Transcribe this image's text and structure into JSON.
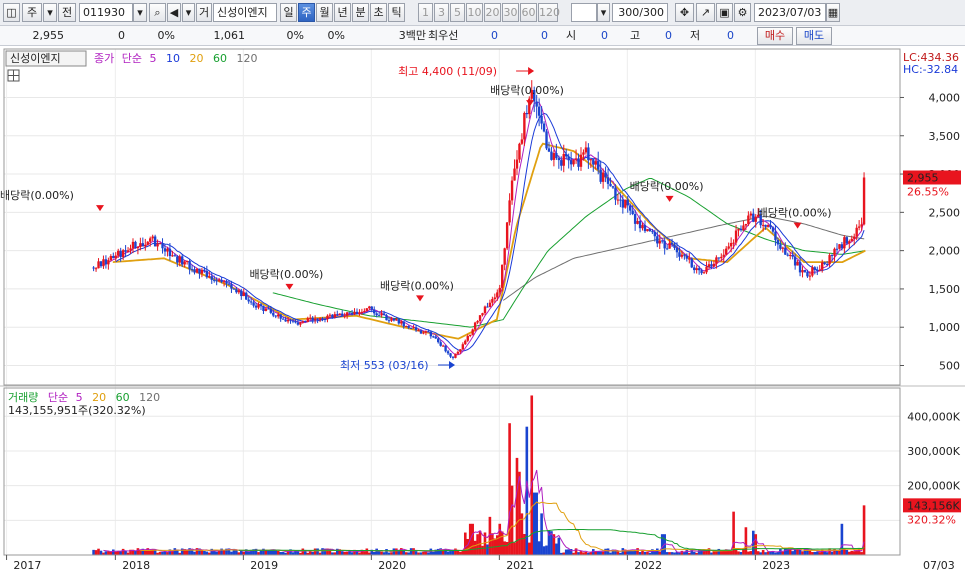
{
  "toolbar": {
    "market_label": "주",
    "prev_label": "전",
    "code": "011930",
    "type_label": "거",
    "stock_name": "신성이엔지",
    "periods": [
      "일",
      "주",
      "월",
      "년",
      "분",
      "초",
      "틱"
    ],
    "selected_period": "주",
    "intervals": [
      "1",
      "3",
      "5",
      "10",
      "20",
      "30",
      "60",
      "120"
    ],
    "count": "300/300",
    "date": "2023/07/03"
  },
  "quote": {
    "price": "2,955",
    "change": "0",
    "change_pct": "0%",
    "volume": "1,061",
    "vol_pct1": "0%",
    "vol_pct2": "0%",
    "bid_unit": "3백만",
    "best_label": "최우선",
    "best1": "0",
    "best2": "0",
    "open_label": "시",
    "open": "0",
    "high_label": "고",
    "high": "0",
    "low_label": "저",
    "low": "0",
    "buy_label": "매수",
    "sell_label": "매도"
  },
  "colors": {
    "up": "#e8141e",
    "down": "#1a44d0",
    "ma5": "#b020c0",
    "ma10": "#1a3ad8",
    "ma20": "#e0a010",
    "ma60": "#18a030",
    "ma120": "#707070"
  },
  "chart_data": [
    {
      "type": "candlestick",
      "legend": {
        "stock": "신성이엔지",
        "price_type": "종가",
        "ma_type": "단순",
        "periods": [
          "5",
          "10",
          "20",
          "60",
          "120"
        ]
      },
      "right_info": {
        "lc": "LC:434.36",
        "hc": "HC:-32.84"
      },
      "y_ticks": [
        500,
        1000,
        1500,
        2000,
        2500,
        3000,
        3500,
        4000
      ],
      "y_tick_labels": [
        "500",
        "1,000",
        "1,500",
        "2,000",
        "2,500",
        "3,000",
        "3,500",
        "4,000"
      ],
      "ylim": [
        350,
        4450
      ],
      "current_price_label": "2,955",
      "current_change_label": "26.55%",
      "x_labels": [
        "2017",
        "2018",
        "2019",
        "2020",
        "2021",
        "2022",
        "2023",
        "07/03"
      ],
      "annotations": {
        "high": "최고 4,400 (11/09)",
        "low": "최저 553 (03/16)",
        "ex_dividend": "배당락(0.00%)"
      },
      "close_path": [
        [
          2017.45,
          1780
        ],
        [
          2017.6,
          1900
        ],
        [
          2017.75,
          2050
        ],
        [
          2017.9,
          2150
        ],
        [
          2018.0,
          2000
        ],
        [
          2018.15,
          1850
        ],
        [
          2018.3,
          1700
        ],
        [
          2018.45,
          1600
        ],
        [
          2018.6,
          1450
        ],
        [
          2018.75,
          1250
        ],
        [
          2018.9,
          1150
        ],
        [
          2019.0,
          1050
        ],
        [
          2019.1,
          1080
        ],
        [
          2019.3,
          1150
        ],
        [
          2019.5,
          1200
        ],
        [
          2019.6,
          1250
        ],
        [
          2019.7,
          1150
        ],
        [
          2019.85,
          1050
        ],
        [
          2020.0,
          950
        ],
        [
          2020.1,
          900
        ],
        [
          2020.2,
          700
        ],
        [
          2020.25,
          600
        ],
        [
          2020.35,
          800
        ],
        [
          2020.45,
          1100
        ],
        [
          2020.55,
          1350
        ],
        [
          2020.62,
          1500
        ],
        [
          2020.68,
          2300
        ],
        [
          2020.72,
          3000
        ],
        [
          2020.78,
          3400
        ],
        [
          2020.86,
          4050
        ],
        [
          2020.92,
          3800
        ],
        [
          2021.0,
          3300
        ],
        [
          2021.1,
          3200
        ],
        [
          2021.2,
          3100
        ],
        [
          2021.3,
          3300
        ],
        [
          2021.4,
          3000
        ],
        [
          2021.5,
          2800
        ],
        [
          2021.6,
          2600
        ],
        [
          2021.7,
          2350
        ],
        [
          2021.8,
          2200
        ],
        [
          2021.9,
          2100
        ],
        [
          2022.0,
          2000
        ],
        [
          2022.1,
          1850
        ],
        [
          2022.2,
          1700
        ],
        [
          2022.3,
          1850
        ],
        [
          2022.4,
          2000
        ],
        [
          2022.5,
          2300
        ],
        [
          2022.6,
          2450
        ],
        [
          2022.7,
          2350
        ],
        [
          2022.8,
          2100
        ],
        [
          2022.9,
          1900
        ],
        [
          2023.0,
          1700
        ],
        [
          2023.1,
          1750
        ],
        [
          2023.2,
          1900
        ],
        [
          2023.3,
          2100
        ],
        [
          2023.38,
          2200
        ],
        [
          2023.45,
          2300
        ],
        [
          2023.48,
          2955
        ]
      ],
      "ma_paths": {
        "ma20": [
          [
            2017.6,
            1850
          ],
          [
            2018.0,
            1900
          ],
          [
            2018.5,
            1550
          ],
          [
            2019.0,
            1100
          ],
          [
            2019.5,
            1150
          ],
          [
            2020.0,
            950
          ],
          [
            2020.3,
            850
          ],
          [
            2020.6,
            1100
          ],
          [
            2020.75,
            2300
          ],
          [
            2020.95,
            3400
          ],
          [
            2021.2,
            3300
          ],
          [
            2021.5,
            2900
          ],
          [
            2021.8,
            2350
          ],
          [
            2022.1,
            1900
          ],
          [
            2022.4,
            1850
          ],
          [
            2022.7,
            2300
          ],
          [
            2023.0,
            1850
          ],
          [
            2023.3,
            1850
          ],
          [
            2023.48,
            2000
          ]
        ],
        "ma60": [
          [
            2018.85,
            1450
          ],
          [
            2019.2,
            1300
          ],
          [
            2019.6,
            1150
          ],
          [
            2020.0,
            1080
          ],
          [
            2020.4,
            1000
          ],
          [
            2020.65,
            1100
          ],
          [
            2020.8,
            1500
          ],
          [
            2021.0,
            2000
          ],
          [
            2021.3,
            2450
          ],
          [
            2021.6,
            2800
          ],
          [
            2021.8,
            2950
          ],
          [
            2022.1,
            2700
          ],
          [
            2022.4,
            2350
          ],
          [
            2022.7,
            2150
          ],
          [
            2023.0,
            2000
          ],
          [
            2023.3,
            1950
          ],
          [
            2023.48,
            2000
          ]
        ],
        "ma120": [
          [
            2020.65,
            1350
          ],
          [
            2020.9,
            1650
          ],
          [
            2021.2,
            1900
          ],
          [
            2021.6,
            2050
          ],
          [
            2022.0,
            2200
          ],
          [
            2022.4,
            2350
          ],
          [
            2022.7,
            2450
          ],
          [
            2023.0,
            2350
          ],
          [
            2023.3,
            2200
          ],
          [
            2023.48,
            2150
          ]
        ]
      }
    },
    {
      "type": "bar",
      "legend": {
        "name": "거래량",
        "ma_type": "단순",
        "periods": [
          "5",
          "20",
          "60",
          "120"
        ],
        "volume_text": "143,155,951주(320.32%)"
      },
      "y_ticks": [
        100000,
        200000,
        300000,
        400000
      ],
      "y_tick_labels": [
        "",
        "200,000K",
        "300,000K",
        "400,000K"
      ],
      "ylim": [
        0,
        470000
      ],
      "current_label": "143,156K",
      "current_pct": "320.32%",
      "current_value": 143156,
      "spikes": [
        [
          2020.4,
          90000
        ],
        [
          2020.45,
          60000
        ],
        [
          2020.55,
          110000
        ],
        [
          2020.62,
          90000
        ],
        [
          2020.7,
          380000
        ],
        [
          2020.72,
          200000
        ],
        [
          2020.75,
          280000
        ],
        [
          2020.78,
          240000
        ],
        [
          2020.8,
          120000
        ],
        [
          2020.84,
          370000
        ],
        [
          2020.87,
          460000
        ],
        [
          2020.9,
          180000
        ],
        [
          2020.95,
          120000
        ],
        [
          2021.0,
          70000
        ],
        [
          2021.05,
          60000
        ],
        [
          2021.9,
          60000
        ],
        [
          2022.45,
          125000
        ],
        [
          2022.55,
          80000
        ],
        [
          2022.6,
          70000
        ],
        [
          2022.62,
          60000
        ],
        [
          2023.3,
          90000
        ],
        [
          2023.48,
          143156
        ]
      ]
    }
  ]
}
